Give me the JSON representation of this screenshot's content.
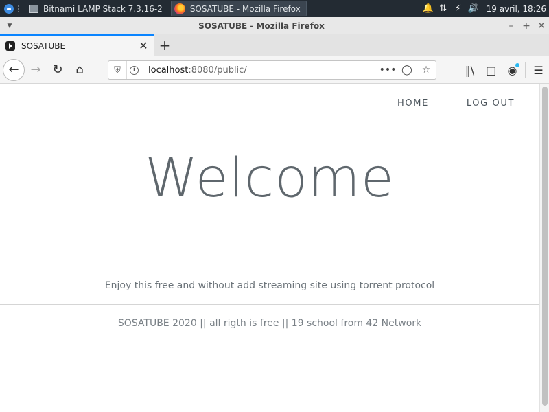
{
  "taskbar": {
    "tasks": [
      {
        "label": "Bitnami LAMP Stack 7.3.16-2",
        "active": false
      },
      {
        "label": "SOSATUBE - Mozilla Firefox",
        "active": true
      }
    ],
    "clock": "19 avril, 18:26"
  },
  "window": {
    "title": "SOSATUBE - Mozilla Firefox"
  },
  "browser": {
    "tab_label": "SOSATUBE",
    "url_host": "localhost",
    "url_rest": ":8080/public/",
    "accent": "#0a84ff"
  },
  "site": {
    "nav": {
      "home": "HOME",
      "logout": "LOG OUT"
    },
    "hero_title": "Welcome",
    "tagline": "Enjoy this free and without add streaming site using torrent protocol",
    "footer": "SOSATUBE 2020 || all rigth is free || 19 school from 42 Network"
  }
}
